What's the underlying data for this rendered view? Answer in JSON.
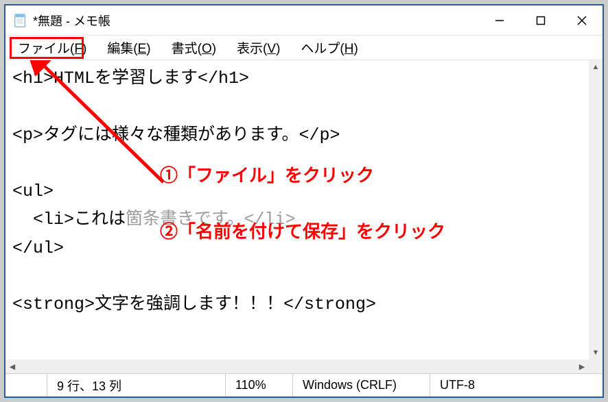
{
  "window": {
    "title": "*無題 - メモ帳"
  },
  "menu": {
    "file": "ファイル(",
    "file_u": "F",
    "file_end": ")",
    "edit": "編集(",
    "edit_u": "E",
    "edit_end": ")",
    "format": "書式(",
    "format_u": "O",
    "format_end": ")",
    "view": "表示(",
    "view_u": "V",
    "view_end": ")",
    "help": "ヘルプ(",
    "help_u": "H",
    "help_end": ")"
  },
  "doc": {
    "l1": "<h1>HTMLを学習します</h1>",
    "l2": "",
    "l3": "<p>タグには様々な種類があります。</p>",
    "l4": "",
    "l5": "<ul>",
    "l6a": "  <li>これは",
    "l6b": "箇条書きです。</li>",
    "l7": "</ul>",
    "l8": "",
    "l9": "<strong>文字を強調します！！！</strong>"
  },
  "status": {
    "pos": "9 行、13 列",
    "zoom": "110%",
    "lineend": "Windows (CRLF)",
    "encoding": "UTF-8"
  },
  "annotations": {
    "one": "①「ファイル」をクリック",
    "two": "②「名前を付けて保存」をクリック"
  }
}
